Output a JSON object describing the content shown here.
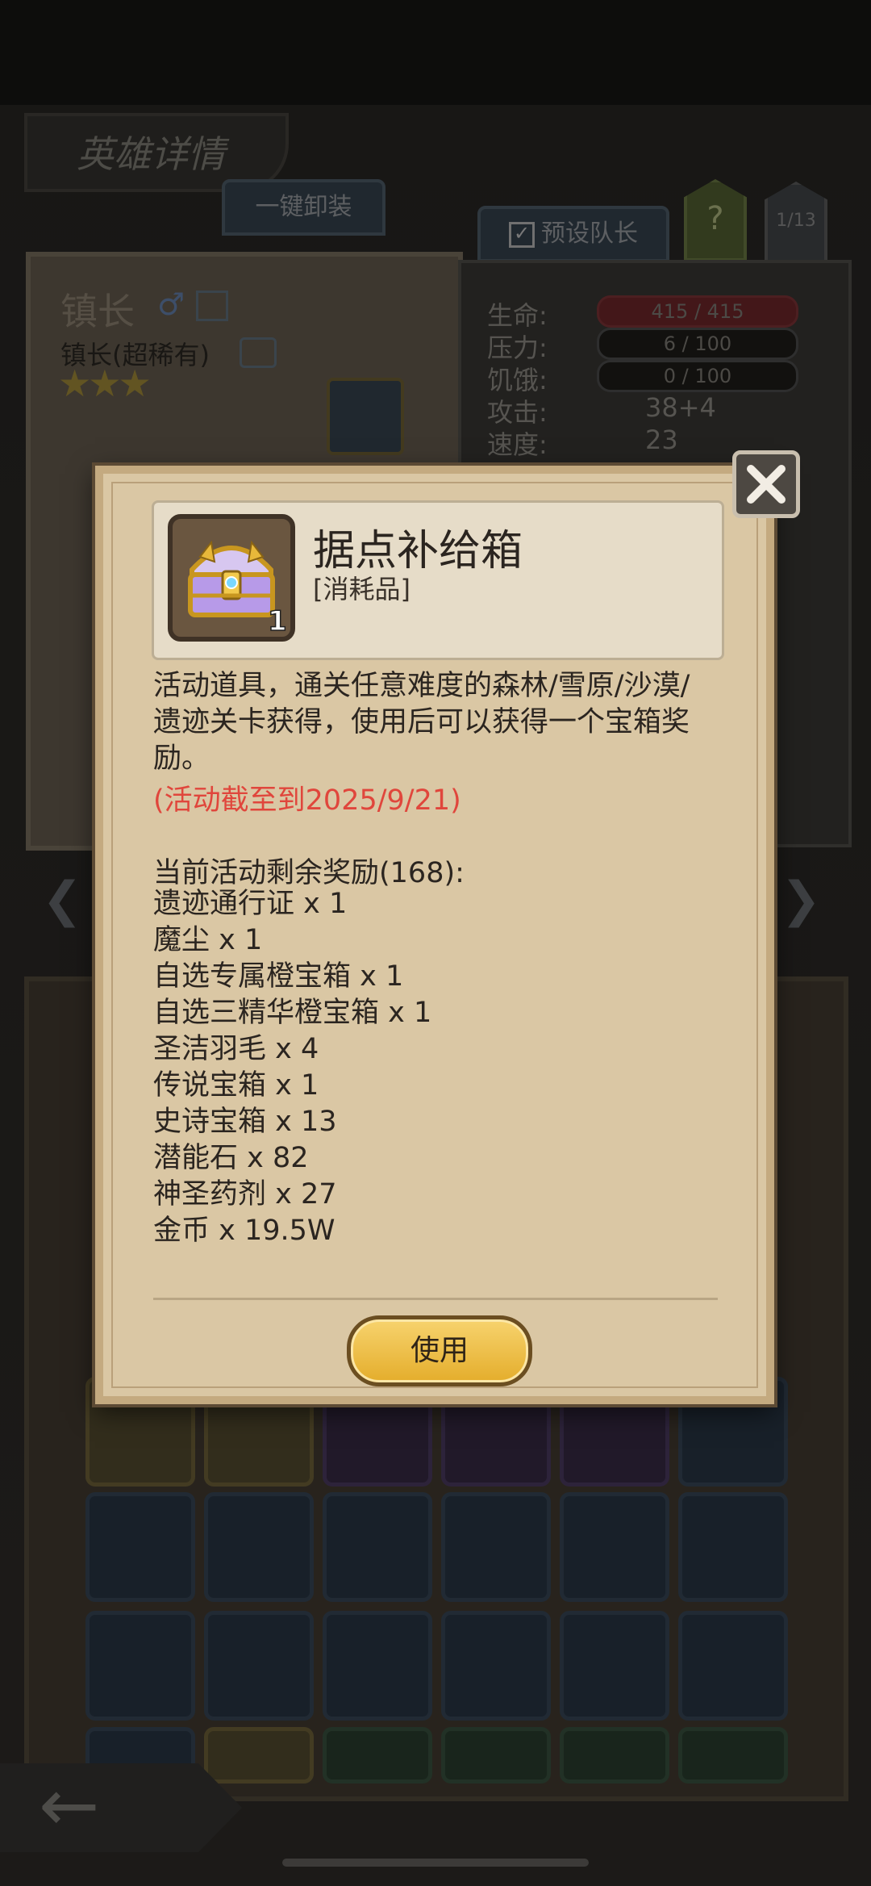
{
  "background": {
    "screen_title": "英雄详情",
    "unequip_all_label": "一键卸装",
    "preset_leader_label": "预设队长",
    "help_label": "?",
    "page_indicator": "1/13",
    "hero_name": "镇长",
    "hero_class": "镇长(超稀有)",
    "stars": 3,
    "stats": {
      "hp_label": "生命:",
      "hp_value": "415 / 415",
      "hp_fraction": 1.0,
      "stress_label": "压力:",
      "stress_value": "6 / 100",
      "stress_fraction": 0.06,
      "hunger_label": "饥饿:",
      "hunger_value": "0 / 100",
      "hunger_fraction": 0.0,
      "attack_label": "攻击:",
      "attack_value": "38+4",
      "speed_label": "速度:",
      "speed_value": "23"
    }
  },
  "dialog": {
    "item_name": "据点补给箱",
    "item_type": "[消耗品]",
    "quantity": "1",
    "description": "活动道具，通关任意难度的森林/雪原/沙漠/遗迹关卡获得，使用后可以获得一个宝箱奖励。",
    "deadline": "(活动截至到2025/9/21)",
    "rewards_title": "当前活动剩余奖励(168):",
    "rewards": [
      "遗迹通行证 x 1",
      "魔尘 x 1",
      "自选专属橙宝箱 x 1",
      "自选三精华橙宝箱 x 1",
      "圣洁羽毛 x 4",
      "传说宝箱 x 1",
      "史诗宝箱 x 13",
      "潜能石 x 82",
      "神圣药剂 x 27",
      "金币 x 19.5W"
    ],
    "use_label": "使用",
    "close_icon": "close-x-icon"
  },
  "colors": {
    "deadline_red": "#e0463c",
    "parchment": "#dac7a4",
    "button_gold": "#f0c14b"
  }
}
